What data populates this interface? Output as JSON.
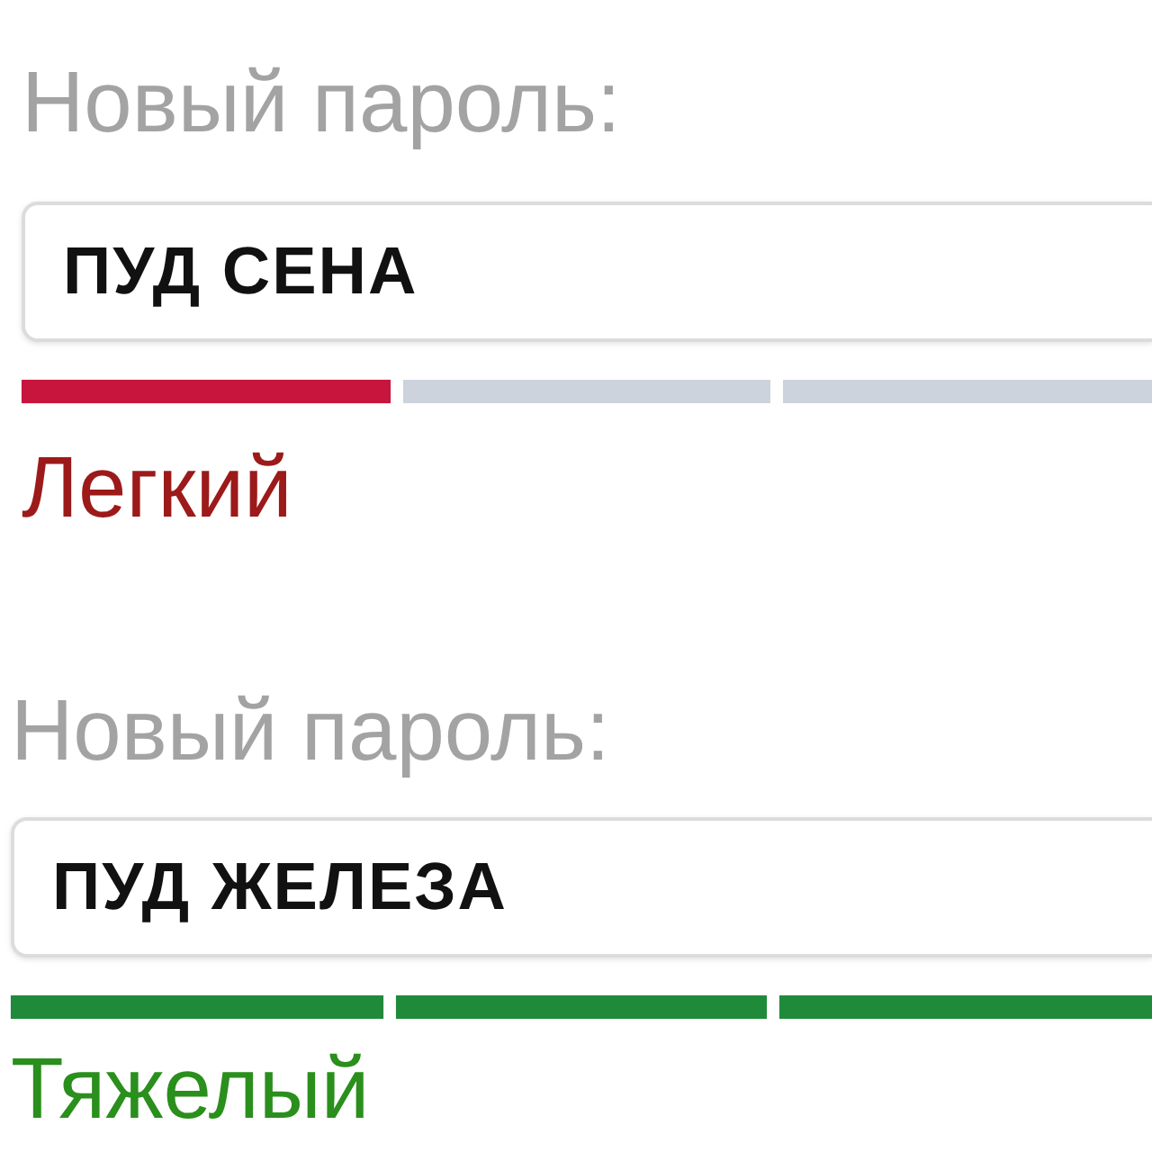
{
  "fields": [
    {
      "label": "Новый пароль:",
      "value": "ПУД СЕНА",
      "kind": "weak",
      "segments": [
        {
          "on": true
        },
        {
          "on": false
        },
        {
          "on": false
        }
      ],
      "strength": "Легкий"
    },
    {
      "label": "Новый пароль:",
      "value": "ПУД ЖЕЛЕЗА",
      "kind": "strong",
      "segments": [
        {
          "on": true
        },
        {
          "on": true
        },
        {
          "on": true
        }
      ],
      "strength": "Тяжелый"
    }
  ]
}
